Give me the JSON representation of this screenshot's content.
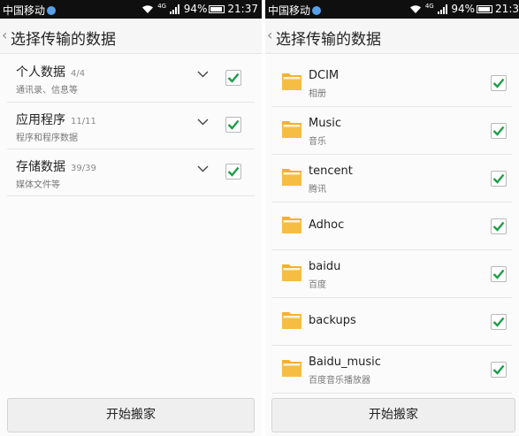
{
  "status_bar": {
    "carrier": "中国移动",
    "network": "4G",
    "battery": "94%",
    "time": "21:37",
    "time_cropped": "21:3"
  },
  "screen_title": "选择传输的数据",
  "categories": [
    {
      "name": "个人数据",
      "count": "4/4",
      "sub": "通讯录、信息等",
      "checked": true
    },
    {
      "name": "应用程序",
      "count": "11/11",
      "sub": "程序和程序数据",
      "checked": true
    },
    {
      "name": "存储数据",
      "count": "39/39",
      "sub": "媒体文件等",
      "checked": true
    }
  ],
  "folders": [
    {
      "name": "DCIM",
      "sub": "相册"
    },
    {
      "name": "Music",
      "sub": "音乐"
    },
    {
      "name": "tencent",
      "sub": "腾讯"
    },
    {
      "name": "Adhoc",
      "sub": ""
    },
    {
      "name": "baidu",
      "sub": "百度"
    },
    {
      "name": "backups",
      "sub": ""
    },
    {
      "name": "Baidu_music",
      "sub": "百度音乐播放器"
    }
  ],
  "start_button_label": "开始搬家",
  "colors": {
    "check_green": "#1e9e48",
    "folder_orange": "#f3b134",
    "status_bar_bg": "#0f0f0f"
  },
  "icons": [
    "back-chevron-icon",
    "expand-chevron-icon",
    "checkmark-icon",
    "folder-icon",
    "wifi-icon",
    "signal-icon",
    "battery-icon"
  ]
}
